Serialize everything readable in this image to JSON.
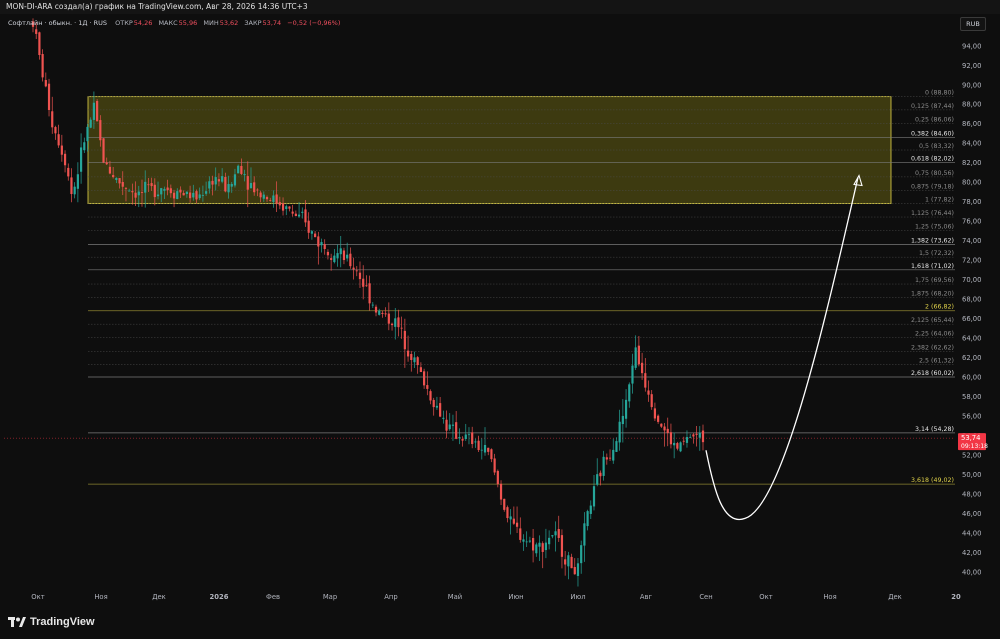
{
  "header": {
    "attribution": "MON-DI-ARA создал(а) график на TradingView.com, Авг 28, 2026 14:36 UTC+3",
    "symbol": "Софтлайн · обыкн. · 1Д · RUS",
    "ohlc": [
      {
        "label": "ОТКР",
        "value": "54,26"
      },
      {
        "label": "МАКС",
        "value": "55,96"
      },
      {
        "label": "МИН",
        "value": "53,62"
      },
      {
        "label": "ЗАКР",
        "value": "53,74"
      }
    ],
    "change": "−0,52 (−0,96%)",
    "currency": "RUB"
  },
  "footer": {
    "brand": "TradingView"
  },
  "colors": {
    "up": "#26a69a",
    "down": "#ef5350",
    "zone_fill": "#4d4a12",
    "zone_border": "#e6d84a",
    "fib_label": "#e0d24a",
    "price_tag": "#f23645",
    "arrow": "#ffffff"
  },
  "chart_data": {
    "type": "candlestick",
    "y_axis": {
      "min": 38,
      "max": 97,
      "ticks": [
        "94,00",
        "92,00",
        "90,00",
        "88,00",
        "86,00",
        "84,00",
        "82,00",
        "80,00",
        "78,00",
        "76,00",
        "74,00",
        "72,00",
        "70,00",
        "68,00",
        "66,00",
        "64,00",
        "62,00",
        "60,00",
        "58,00",
        "56,00",
        "54,00",
        "52,00",
        "50,00",
        "48,00",
        "46,00",
        "44,00",
        "42,00",
        "40,00"
      ]
    },
    "x_axis": {
      "labels": [
        "Окт",
        "Ноя",
        "Дек",
        "2026",
        "Фев",
        "Мар",
        "Апр",
        "Май",
        "Июн",
        "Июл",
        "Авг",
        "Сен",
        "Окт",
        "Ноя",
        "Дек",
        "20"
      ]
    },
    "last_price": {
      "value": "53,74",
      "countdown": "09:13:18",
      "numeric": 53.74
    },
    "fib_levels": [
      {
        "label": "0 (88,80)",
        "price": 88.8,
        "bold": false
      },
      {
        "label": "0,125 (87,44)",
        "price": 87.44,
        "bold": false
      },
      {
        "label": "0,25 (86,06)",
        "price": 86.06,
        "bold": false
      },
      {
        "label": "0,382 (84,60)",
        "price": 84.6,
        "bold": true
      },
      {
        "label": "0,5 (83,32)",
        "price": 83.32,
        "bold": false
      },
      {
        "label": "0,618 (82,02)",
        "price": 82.02,
        "bold": true
      },
      {
        "label": "0,75 (80,56)",
        "price": 80.56,
        "bold": false
      },
      {
        "label": "0,875 (79,18)",
        "price": 79.18,
        "bold": false
      },
      {
        "label": "1 (77,82)",
        "price": 77.82,
        "bold": false
      },
      {
        "label": "1,125 (76,44)",
        "price": 76.44,
        "bold": false
      },
      {
        "label": "1,25 (75,06)",
        "price": 75.06,
        "bold": false
      },
      {
        "label": "1,382 (73,62)",
        "price": 73.62,
        "bold": true
      },
      {
        "label": "1,5 (72,32)",
        "price": 72.32,
        "bold": false
      },
      {
        "label": "1,618 (71,02)",
        "price": 71.02,
        "bold": true
      },
      {
        "label": "1,75 (69,56)",
        "price": 69.56,
        "bold": false
      },
      {
        "label": "1,875 (68,20)",
        "price": 68.2,
        "bold": false
      },
      {
        "label": "2 (66,82)",
        "price": 66.82,
        "bold": true,
        "yellow": true
      },
      {
        "label": "2,125 (65,44)",
        "price": 65.44,
        "bold": false
      },
      {
        "label": "2,25 (64,06)",
        "price": 64.06,
        "bold": false
      },
      {
        "label": "2,382 (62,62)",
        "price": 62.62,
        "bold": false
      },
      {
        "label": "2,5 (61,32)",
        "price": 61.32,
        "bold": false
      },
      {
        "label": "2,618 (60,02)",
        "price": 60.02,
        "bold": true
      },
      {
        "label": "3,14 (54,28)",
        "price": 54.28,
        "bold": true
      },
      {
        "label": "3,618 (49,02)",
        "price": 49.02,
        "bold": true,
        "yellow": true
      }
    ],
    "zone": {
      "top": 88.8,
      "bottom": 77.82
    },
    "price_path": [
      [
        0,
        96.5
      ],
      [
        0.04,
        91.0
      ],
      [
        0.08,
        86.0
      ],
      [
        0.13,
        82.5
      ],
      [
        0.16,
        78.5
      ],
      [
        0.21,
        84.5
      ],
      [
        0.25,
        87.5
      ],
      [
        0.29,
        82.0
      ],
      [
        0.35,
        80.0
      ],
      [
        0.43,
        78.8
      ],
      [
        0.52,
        79.6
      ],
      [
        0.6,
        79.0
      ],
      [
        0.67,
        78.4
      ],
      [
        0.74,
        80.6
      ],
      [
        0.8,
        79.2
      ],
      [
        0.84,
        82.0
      ],
      [
        0.88,
        80.0
      ],
      [
        0.92,
        79.0
      ],
      [
        1.0,
        78.0
      ],
      [
        1.1,
        76.0
      ],
      [
        1.16,
        74.0
      ],
      [
        1.25,
        72.5
      ],
      [
        1.32,
        71.0
      ],
      [
        1.4,
        66.8
      ],
      [
        1.48,
        65.5
      ],
      [
        1.55,
        62.0
      ],
      [
        1.62,
        58.0
      ],
      [
        1.7,
        54.5
      ],
      [
        1.78,
        53.5
      ],
      [
        1.86,
        52.0
      ],
      [
        1.94,
        45.0
      ],
      [
        2.0,
        43.5
      ],
      [
        2.06,
        42.5
      ],
      [
        2.12,
        44.0
      ],
      [
        2.18,
        41.0
      ],
      [
        2.22,
        40.0
      ],
      [
        2.26,
        46.0
      ],
      [
        2.32,
        51.0
      ],
      [
        2.38,
        54.0
      ],
      [
        2.42,
        57.5
      ],
      [
        2.45,
        63.0
      ],
      [
        2.49,
        60.0
      ],
      [
        2.55,
        55.5
      ],
      [
        2.62,
        52.5
      ],
      [
        2.68,
        54.0
      ],
      [
        2.73,
        53.7
      ]
    ],
    "projection": {
      "from": {
        "y": 52.5
      },
      "bottom": {
        "y": 45.5
      },
      "to": {
        "y": 80.5
      }
    }
  }
}
